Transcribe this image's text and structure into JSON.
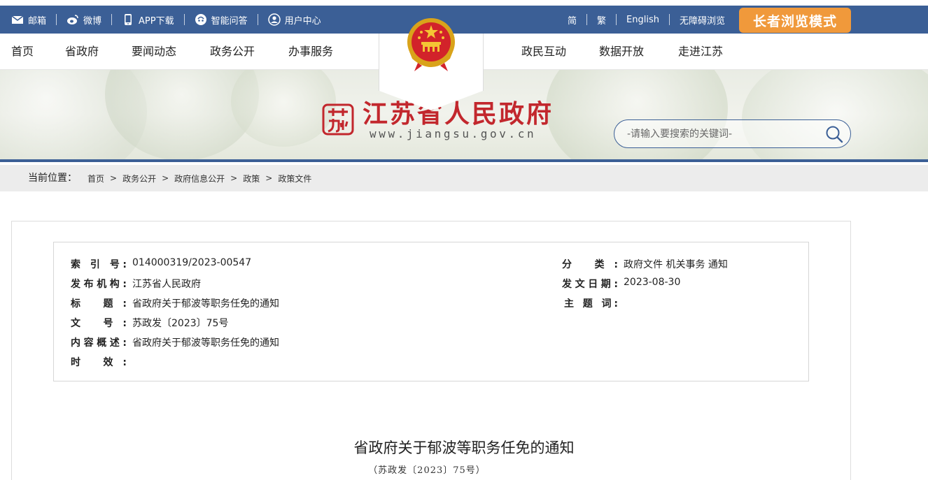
{
  "topbar": {
    "items": [
      {
        "label": "邮箱",
        "icon": "mail-icon"
      },
      {
        "label": "微博",
        "icon": "weibo-icon"
      },
      {
        "label": "APP下载",
        "icon": "phone-icon"
      },
      {
        "label": "智能问答",
        "icon": "chat-icon"
      },
      {
        "label": "用户中心",
        "icon": "user-icon"
      }
    ],
    "lang": [
      "简",
      "繁",
      "English",
      "无障碍浏览"
    ],
    "elder_mode": "长者浏览模式"
  },
  "nav": {
    "left": [
      "首页",
      "省政府",
      "要闻动态",
      "政务公开",
      "办事服务"
    ],
    "right": [
      "政民互动",
      "数据开放",
      "走进江苏"
    ]
  },
  "banner": {
    "title": "江苏省人民政府",
    "url": "www.jiangsu.gov.cn",
    "search_placeholder": "-请输入要搜索的关键词-"
  },
  "breadcrumb": {
    "label": "当前位置：",
    "items": [
      "首页",
      "政务公开",
      "政府信息公开",
      "政策",
      "政策文件"
    ]
  },
  "meta": {
    "index_key": "索 引 号:",
    "index_val": "014000319/2023-00547",
    "org_key": "发布机构:",
    "org_val": "江苏省人民政府",
    "title_key": "标 题:",
    "title_val": "省政府关于郁波等职务任免的通知",
    "docno_key": "文 号:",
    "docno_val": "苏政发〔2023〕75号",
    "summary_key": "内容概述:",
    "summary_val": "省政府关于郁波等职务任免的通知",
    "validity_key": "时 效:",
    "validity_val": "",
    "category_key": "分 类:",
    "category_val": "政府文件 机关事务 通知",
    "date_key": "发文日期:",
    "date_val": "2023-08-30",
    "subject_key": "主 题 词:",
    "subject_val": ""
  },
  "document": {
    "title": "省政府关于郁波等职务任免的通知",
    "number": "（苏政发〔2023〕75号）"
  },
  "colors": {
    "topbar": "#3b5f96",
    "elder_button": "#f0993b",
    "title_red": "#c2272d"
  }
}
